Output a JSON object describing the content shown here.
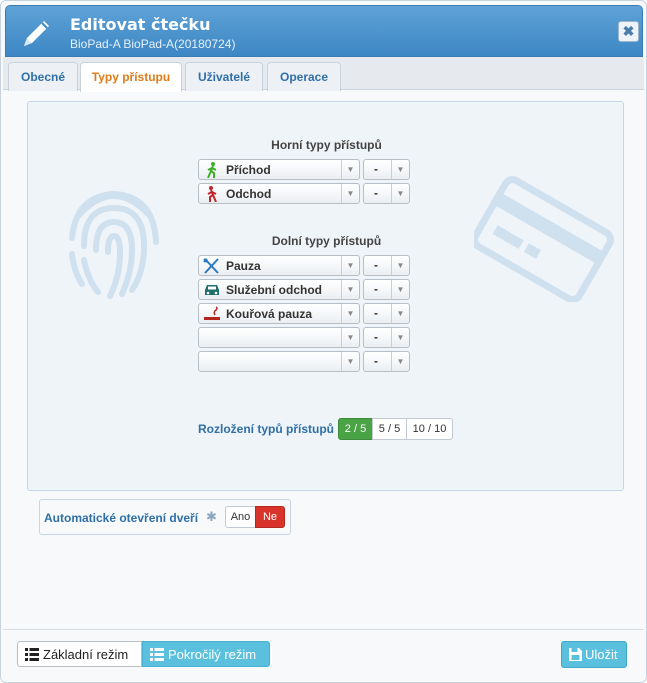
{
  "header": {
    "title": "Editovat čtečku",
    "subtitle": "BioPad-A BioPad-A(20180724)",
    "close_glyph": "✖"
  },
  "tabs": [
    {
      "label": "Obecné",
      "active": false
    },
    {
      "label": "Typy přístupu",
      "active": true
    },
    {
      "label": "Uživatelé",
      "active": false
    },
    {
      "label": "Operace",
      "active": false
    }
  ],
  "upper": {
    "title": "Horní typy přístupů",
    "rows": [
      {
        "label": "Příchod",
        "icon": "walk-in-icon",
        "value": "-"
      },
      {
        "label": "Odchod",
        "icon": "walk-out-icon",
        "value": "-"
      }
    ]
  },
  "lower": {
    "title": "Dolní typy přístupů",
    "rows": [
      {
        "label": "Pauza",
        "icon": "cutlery-icon",
        "value": "-"
      },
      {
        "label": "Služební odchod",
        "icon": "car-icon",
        "value": "-"
      },
      {
        "label": "Kouřová pauza",
        "icon": "cigarette-icon",
        "value": "-"
      },
      {
        "label": "",
        "icon": "",
        "value": "-"
      },
      {
        "label": "",
        "icon": "",
        "value": "-"
      }
    ]
  },
  "layout": {
    "label": "Rozložení typů přístupů",
    "options": [
      "2 / 5",
      "5 / 5",
      "10 / 10"
    ],
    "selected": "2 / 5"
  },
  "auto_open": {
    "label": "Automatické otevření dveří",
    "options": [
      "Ano",
      "Ne"
    ],
    "selected": "Ne",
    "star": "✱"
  },
  "footer": {
    "basic_mode": "Základní režim",
    "advanced_mode": "Pokročilý režim",
    "save": "Uložit"
  },
  "colors": {
    "header": "#3d87c5",
    "active_tab_text": "#e07b1a",
    "layout_selected": "#4aa345",
    "no_selected": "#d9342b",
    "info_button": "#5bc0de"
  }
}
